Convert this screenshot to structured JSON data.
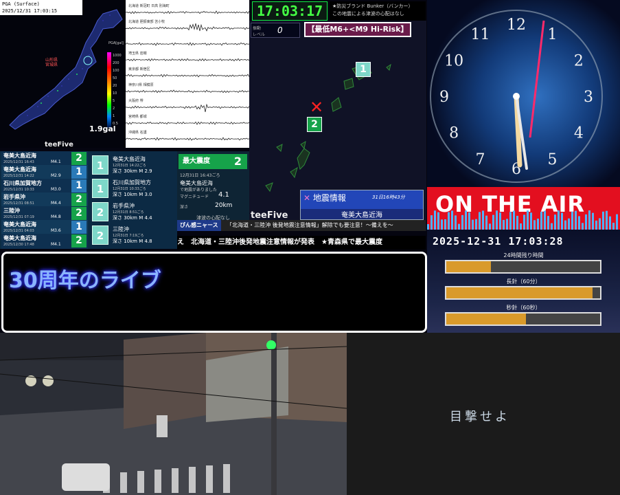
{
  "pga": {
    "title": "PGA (Surface)",
    "datetime": "2025/12/31 17:03:15",
    "gal": "1.9gal",
    "scale_label": "PGA[gal]",
    "scale_ticks": [
      "1000",
      "200",
      "100",
      "50",
      "20",
      "10",
      "5",
      "2",
      "1",
      "0.5"
    ],
    "brand": "teeFive",
    "tag1": "山形県",
    "tag2": "宮城県"
  },
  "waveforms": {
    "stations": [
      "北海道 新冠町 日高 別海町",
      "北海道 胆振東部 苫小牧",
      "",
      "埼玉県 岩槻",
      "東京都 新宿区",
      "神奈川県 相模原",
      "大阪府 堺",
      "宮崎県 都城",
      "沖縄県 名護"
    ]
  },
  "clock_digital": "17:03:17",
  "bunker": {
    "line1": "★防災ブランド Bunker（バンカー）",
    "line2": "この地震による津波の心配はなし"
  },
  "quake_map": {
    "level_label": "振動\nレベル",
    "level_value": "0",
    "risk_label": "【最低M6+<M9 Hi-Risk】",
    "pin1": "1",
    "pin2": "2",
    "info_title": "地震情報",
    "info_time": "31日16時43分",
    "info_location": "奄美大島近海",
    "brand": "teeFive"
  },
  "quake_list": [
    {
      "name": "奄美大島近海",
      "date": "2025/12/31 16:43",
      "mag": "M4.1",
      "shindo": "2",
      "color": "#16a34a"
    },
    {
      "name": "奄美大島近海",
      "date": "2025/12/31 14:22",
      "mag": "M2.9",
      "shindo": "1",
      "color": "#2a7ab8"
    },
    {
      "name": "石川県加賀地方",
      "date": "2025/12/31 10:33",
      "mag": "M3.0",
      "shindo": "1",
      "color": "#2a7ab8"
    },
    {
      "name": "岩手県沖",
      "date": "2025/12/31 08:51",
      "mag": "M4.4",
      "shindo": "2",
      "color": "#16a34a"
    },
    {
      "name": "三陸沖",
      "date": "2025/12/31 07:19",
      "mag": "M4.8",
      "shindo": "2",
      "color": "#16a34a"
    },
    {
      "name": "奄美大島近海",
      "date": "2025/12/31 04:03",
      "mag": "M3.6",
      "shindo": "1",
      "color": "#2a7ab8"
    },
    {
      "name": "奄美大島近海",
      "date": "2025/12/30 17:48",
      "mag": "M4.1",
      "shindo": "2",
      "color": "#16a34a"
    }
  ],
  "quake_detail": [
    {
      "shindo": "1",
      "name": "奄美大島近海",
      "date": "12月31日 14:22ごろ",
      "mag": "深さ 30km  M 2.9"
    },
    {
      "shindo": "1",
      "name": "石川県加賀地方",
      "date": "12月31日 10:33ごろ",
      "mag": "深さ 10km  M 3.0"
    },
    {
      "shindo": "2",
      "name": "岩手県沖",
      "date": "12月31日 8:51ごろ",
      "mag": "深さ 30km  M 4.4"
    },
    {
      "shindo": "2",
      "name": "三陸沖",
      "date": "12月31日 7:19ごろ",
      "mag": "深さ 10km  M 4.8"
    }
  ],
  "max_shindo": {
    "label": "最大震度",
    "value": "2",
    "date": "12月31日 16:43ごろ",
    "location": "奄美大島近海",
    "sub": "で地震がありました",
    "mag_label": "マグニチュード",
    "mag_value": "4.1",
    "depth_label": "深さ",
    "depth_value": "20km"
  },
  "tsunami": {
    "line": "津波の心配なし",
    "btn": "ぴん感ニャース"
  },
  "ticker1": {
    "badge": "「北海道・三陸沖 後発地震注意情報」解除でも要注意！〜備えを〜"
  },
  "ticker2": "え　北海道・三陸沖後発地震注意情報が発表　★青森県で最大震度",
  "banner": "30周年のライブ",
  "on_air": "ON THE AIR",
  "datetime_panel": "2025-12-31 17:03:28",
  "bars": [
    {
      "label": "24時間残り時間",
      "fill": 0.29
    },
    {
      "label": "長針（60分）",
      "fill": 0.95
    },
    {
      "label": "秒針（60秒）",
      "fill": 0.52
    }
  ],
  "witness": "目撃せよ"
}
